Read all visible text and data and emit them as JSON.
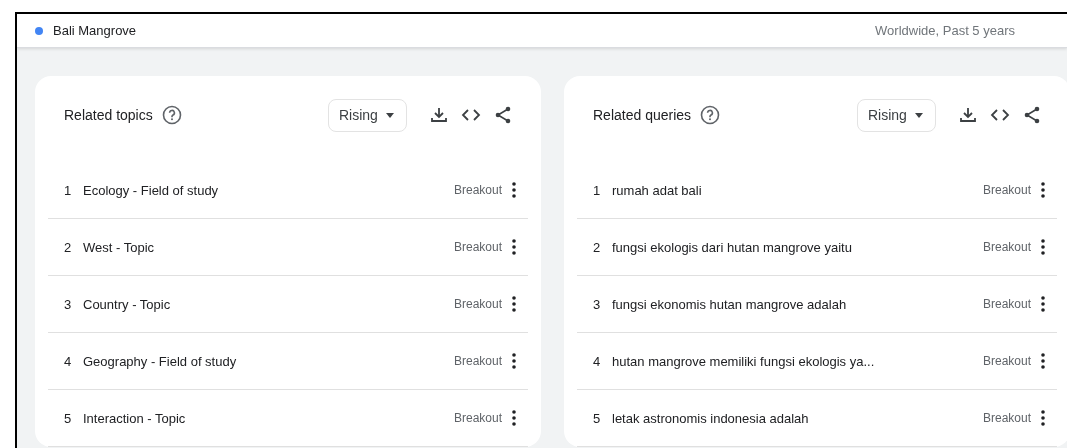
{
  "header": {
    "term": "Bali Mangrove",
    "color": "#4285f4",
    "scope": "Worldwide, Past 5 years"
  },
  "panels": [
    {
      "title": "Related topics",
      "filter": "Rising",
      "rows": [
        {
          "rank": "1",
          "label": "Ecology - Field of study",
          "value": "Breakout"
        },
        {
          "rank": "2",
          "label": "West - Topic",
          "value": "Breakout"
        },
        {
          "rank": "3",
          "label": "Country - Topic",
          "value": "Breakout"
        },
        {
          "rank": "4",
          "label": "Geography - Field of study",
          "value": "Breakout"
        },
        {
          "rank": "5",
          "label": "Interaction - Topic",
          "value": "Breakout"
        }
      ]
    },
    {
      "title": "Related queries",
      "filter": "Rising",
      "rows": [
        {
          "rank": "1",
          "label": "rumah adat bali",
          "value": "Breakout"
        },
        {
          "rank": "2",
          "label": "fungsi ekologis dari hutan mangrove yaitu",
          "value": "Breakout"
        },
        {
          "rank": "3",
          "label": "fungsi ekonomis hutan mangrove adalah",
          "value": "Breakout"
        },
        {
          "rank": "4",
          "label": "hutan mangrove memiliki fungsi ekologis ya...",
          "value": "Breakout"
        },
        {
          "rank": "5",
          "label": "letak astronomis indonesia adalah",
          "value": "Breakout"
        }
      ]
    }
  ]
}
